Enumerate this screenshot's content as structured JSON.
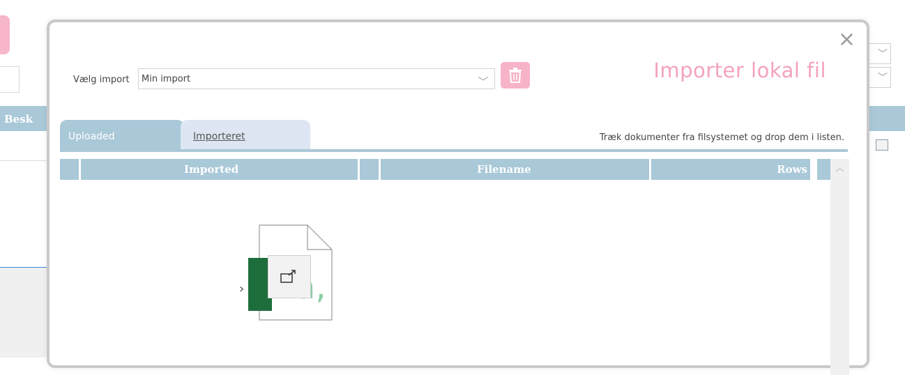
{
  "background": {
    "bar_label": "Besk"
  },
  "modal": {
    "title": "Importer lokal fil",
    "close_glyph": "×",
    "import_label": "Vælg import",
    "import_value": "Min import",
    "tabs": [
      {
        "label": "Uploaded",
        "active": true
      },
      {
        "label": "Importeret",
        "active": false
      }
    ],
    "hint": "Træk dokumenter fra filsystemet og drop dem i listen.",
    "columns": [
      "Imported",
      "Filename",
      "Rows"
    ]
  },
  "colors": {
    "accent_pink": "#f4a3bd",
    "header_blue": "#a9c8d8",
    "excel_green": "#1e6e3b"
  },
  "icons": [
    "close-icon",
    "trash-icon",
    "chevron-down-icon",
    "scroll-up-icon",
    "excel-file-icon",
    "external-link-icon",
    "folder-icon"
  ]
}
